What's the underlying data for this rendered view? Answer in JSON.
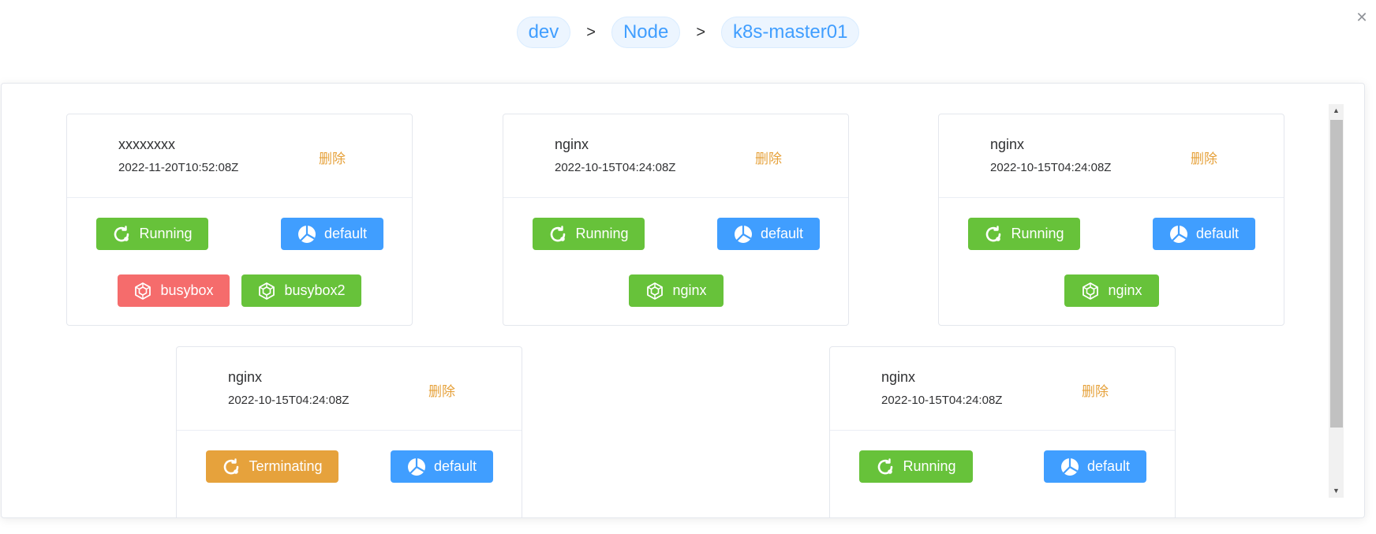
{
  "breadcrumb": {
    "items": [
      "dev",
      "Node",
      "k8s-master01"
    ],
    "separator": ">"
  },
  "close_symbol": "✕",
  "pods": [
    {
      "name": "xxxxxxxx",
      "time": "2022-11-20T10:52:08Z",
      "delete_label": "删除",
      "status": {
        "label": "Running",
        "color": "#67c23a",
        "icon": "refresh-icon"
      },
      "namespace": {
        "label": "default",
        "color": "#409eff",
        "icon": "pie-chart-icon"
      },
      "containers": [
        {
          "label": "busybox",
          "color": "#f56c6c",
          "icon": "cube-icon"
        },
        {
          "label": "busybox2",
          "color": "#67c23a",
          "icon": "cube-icon"
        }
      ]
    },
    {
      "name": "nginx",
      "time": "2022-10-15T04:24:08Z",
      "delete_label": "删除",
      "status": {
        "label": "Running",
        "color": "#67c23a",
        "icon": "refresh-icon"
      },
      "namespace": {
        "label": "default",
        "color": "#409eff",
        "icon": "pie-chart-icon"
      },
      "containers": [
        {
          "label": "nginx",
          "color": "#67c23a",
          "icon": "cube-icon"
        }
      ]
    },
    {
      "name": "nginx",
      "time": "2022-10-15T04:24:08Z",
      "delete_label": "删除",
      "status": {
        "label": "Running",
        "color": "#67c23a",
        "icon": "refresh-icon"
      },
      "namespace": {
        "label": "default",
        "color": "#409eff",
        "icon": "pie-chart-icon"
      },
      "containers": [
        {
          "label": "nginx",
          "color": "#67c23a",
          "icon": "cube-icon"
        }
      ]
    },
    {
      "name": "nginx",
      "time": "2022-10-15T04:24:08Z",
      "delete_label": "删除",
      "status": {
        "label": "Terminating",
        "color": "#e6a23c",
        "icon": "refresh-icon"
      },
      "namespace": {
        "label": "default",
        "color": "#409eff",
        "icon": "pie-chart-icon"
      },
      "containers": []
    },
    {
      "name": "nginx",
      "time": "2022-10-15T04:24:08Z",
      "delete_label": "删除",
      "status": {
        "label": "Running",
        "color": "#67c23a",
        "icon": "refresh-icon"
      },
      "namespace": {
        "label": "default",
        "color": "#409eff",
        "icon": "pie-chart-icon"
      },
      "containers": []
    }
  ]
}
